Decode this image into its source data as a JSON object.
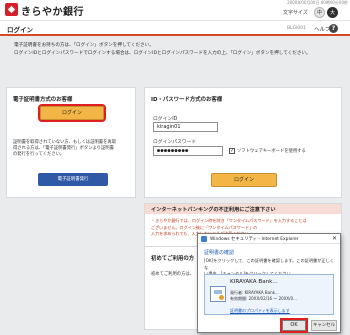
{
  "header": {
    "bank_name": "きらやか銀行",
    "timestamp": "2000年00月00日 00時00分00秒",
    "font_size_label": "文字サイズ",
    "font_medium": "中",
    "font_large": "大"
  },
  "titlebar": {
    "title": "ログイン",
    "page_code": "BLGI001",
    "help_label": "ヘルプ",
    "help_icon": "?"
  },
  "intro": {
    "line1": "電子証明書をお持ちの方は、「ログイン」ボタンを押してください。",
    "line2": "ログインIDとログインパスワードでログインする場合は、ログインIDとログインパスワードを入力の上、「ログイン」ボタンを押してください。"
  },
  "cert_panel": {
    "heading": "電子証明書方式のお客様",
    "login_label": "ログイン",
    "note_line1": "証明書を取得されていない方、もしくは証明書を再取",
    "note_line2": "得される方は、「電子証明書発行」ボタンより証明書",
    "note_line3": "の発行を行ってください。",
    "issue_label": "電子証明書発行"
  },
  "idpw_panel": {
    "heading": "ID・パスワード方式のお客様",
    "id_label": "ログインID",
    "id_value": "kiragin01",
    "pw_label": "ログインパスワード",
    "pw_value": "●●●●●●●●●",
    "soft_kb_label": "ソフトウェアキーボードを使用する",
    "soft_kb_checked": "✓",
    "login_label": "ログイン"
  },
  "warning": {
    "title": "インターネットバンキングの不正利用にご注意下さい",
    "line1": "・きらやか銀行では、ログイン時を除き「ワンタイムパスワード」を入力することは",
    "line2": "ございません。ログイン後に「ワンタイムパスワード」の",
    "line3": "入力を求められても、入力しないようご注意ください。"
  },
  "first_panel": {
    "title": "初めてご利用の方",
    "text": "初めてご利用の方は、"
  },
  "dialog": {
    "title": "Windows セキュリティ - Internet Explorer",
    "close": "✕",
    "heading": "証明書の確認",
    "desc_line1": "[OK]をクリックして、この証明書を確認します。この証明書が正しくな",
    "desc_line2": "い場合、[キャンセル]をクリックしてください。",
    "cert_name": "KIRAYAKA Bank...",
    "cert_issuer": "発行者: KIRAYAKA Bank...",
    "cert_valid": "有効期間: 20XX/02/16 ～ 20XX/0...",
    "cert_props": "証明書のプロパティを表示します",
    "ok_label": "OK",
    "cancel_label": "キャンセル"
  }
}
